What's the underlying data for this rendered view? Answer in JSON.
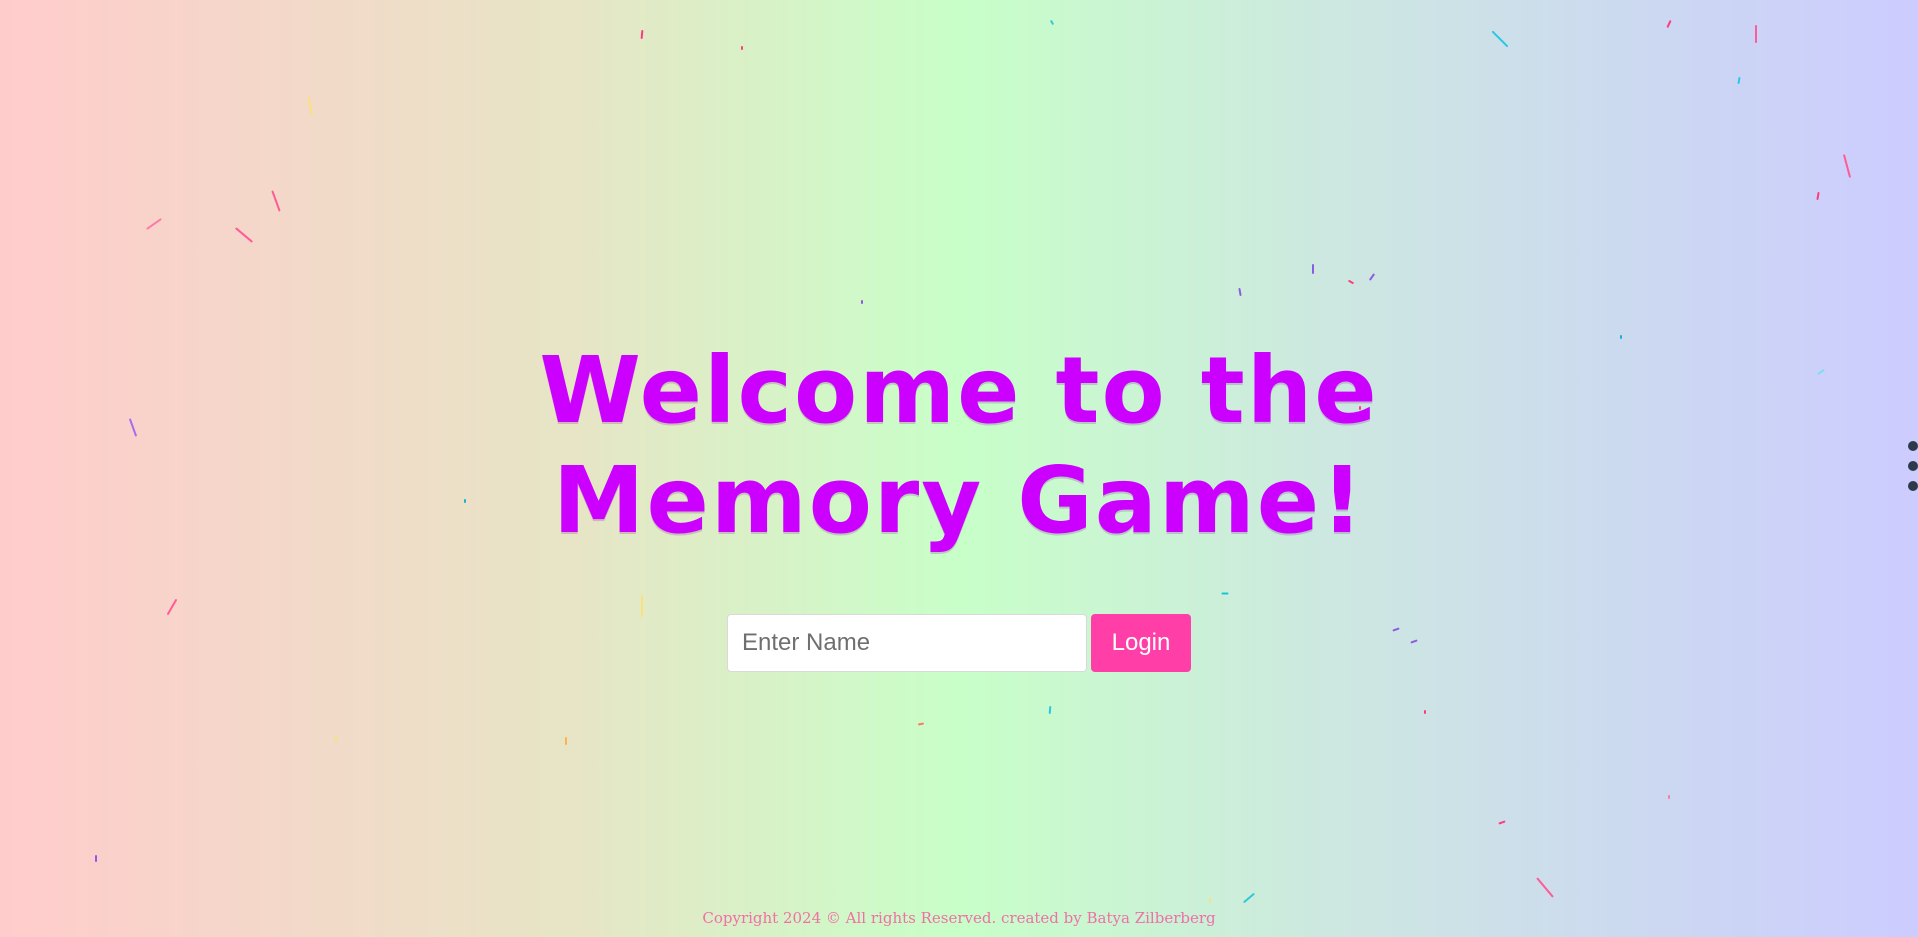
{
  "page": {
    "title_line_1": "Welcome to the",
    "title_line_2": "Memory Game!"
  },
  "login": {
    "input_placeholder": "Enter Name",
    "input_value": "",
    "button_label": "Login"
  },
  "footer": {
    "text": "Copyright 2024 © All rights Reserved. created by Batya Zilberberg"
  },
  "menu": {
    "icon": "kebab-menu-icon"
  },
  "colors": {
    "title": "#cc00ff",
    "button": "#ff3fa7",
    "footer": "#f06fa6"
  }
}
